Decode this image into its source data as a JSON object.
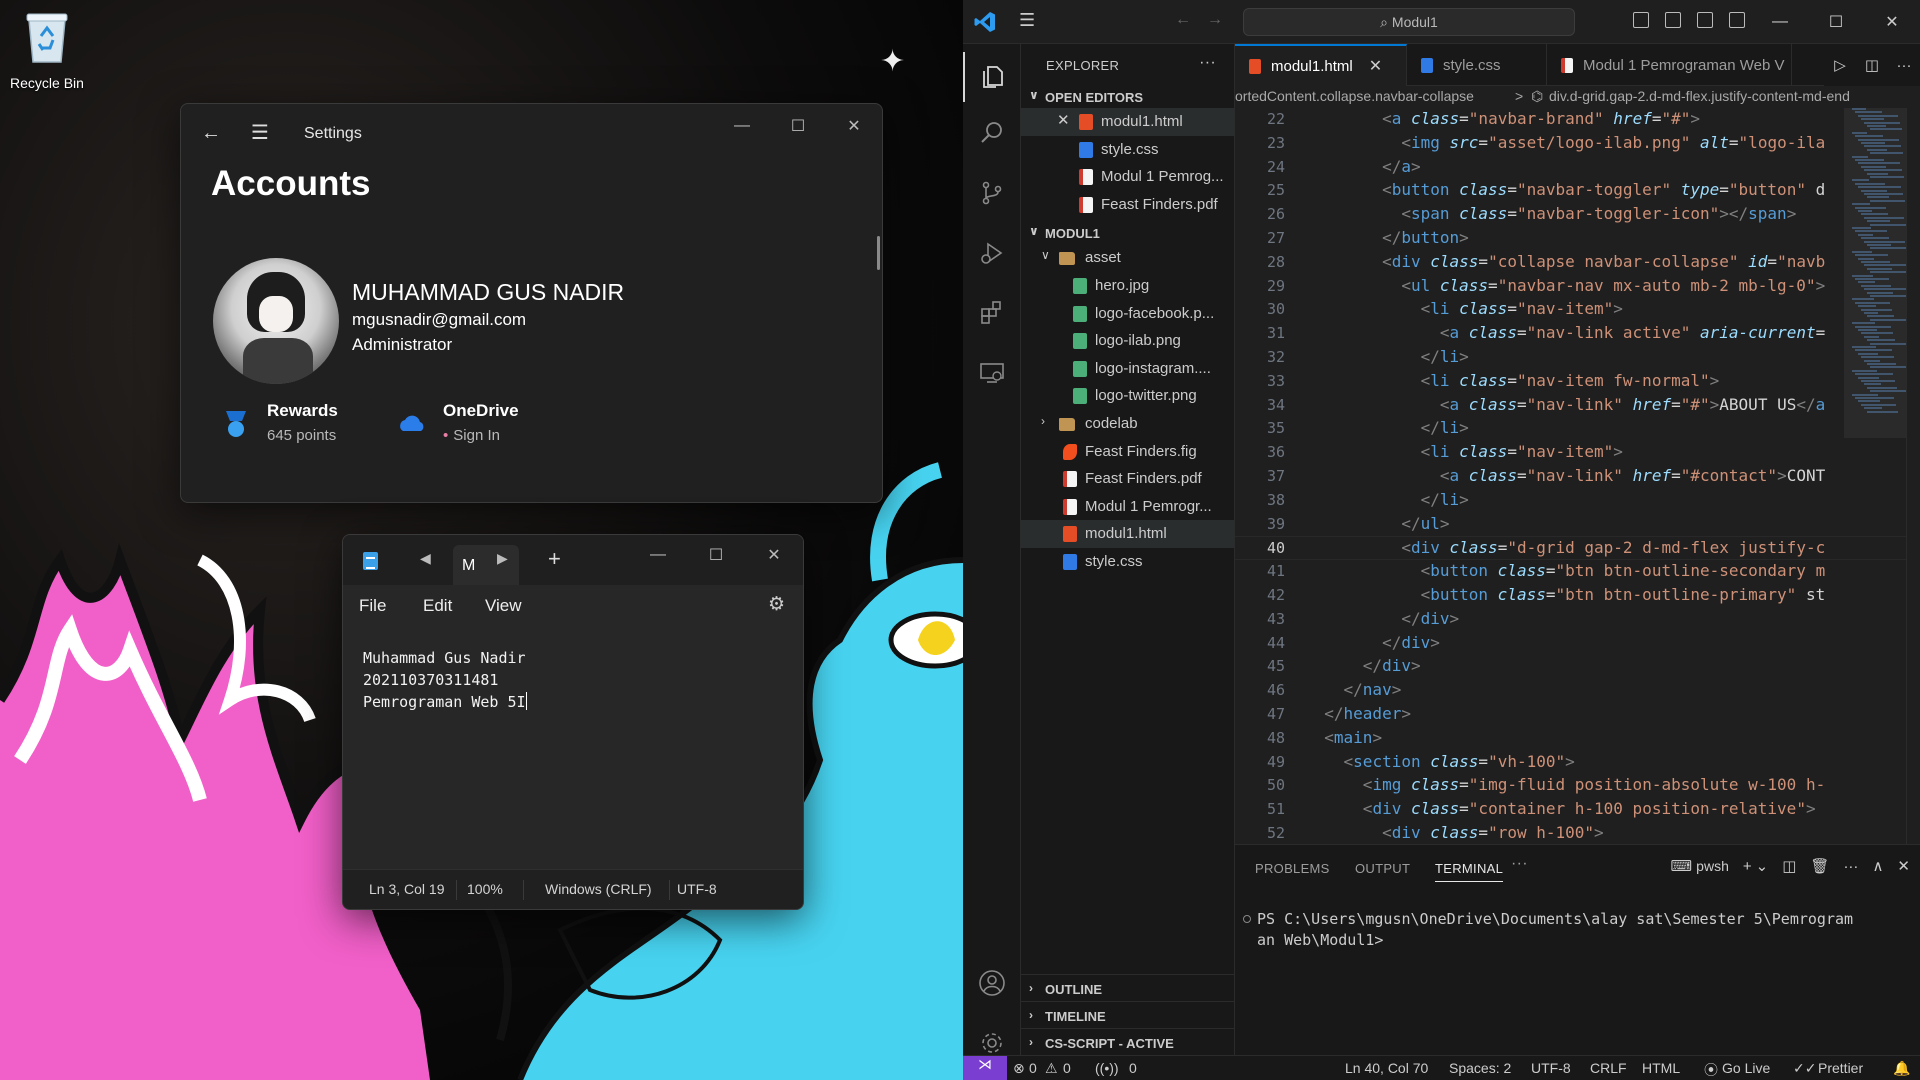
{
  "desktop": {
    "recycle_bin_label": "Recycle Bin"
  },
  "settings": {
    "window_title": "Settings",
    "page_title": "Accounts",
    "user_name": "MUHAMMAD GUS NADIR",
    "user_email": "mgusnadir@gmail.com",
    "user_role": "Administrator",
    "rewards": {
      "title": "Rewards",
      "subtitle": "645 points"
    },
    "onedrive": {
      "title": "OneDrive",
      "subtitle": "Sign In"
    }
  },
  "notepad": {
    "tab_label": "M",
    "menu": [
      "File",
      "Edit",
      "View"
    ],
    "lines": [
      "Muhammad Gus Nadir",
      "202110370311481",
      "Pemrograman Web 5I"
    ],
    "status": {
      "position": "Ln 3, Col 19",
      "zoom": "100%",
      "line_ending": "Windows (CRLF)",
      "encoding": "UTF-8"
    }
  },
  "vscode": {
    "search_label": "Modul1",
    "explorer_title": "EXPLORER",
    "open_editors_label": "OPEN EDITORS",
    "open_editors": [
      {
        "name": "modul1.html",
        "type": "html"
      },
      {
        "name": "style.css",
        "type": "css"
      },
      {
        "name": "Modul 1 Pemrog...",
        "type": "pdf"
      },
      {
        "name": "Feast Finders.pdf",
        "type": "pdf"
      }
    ],
    "workspace_label": "MODUL1",
    "tree": [
      {
        "name": "asset",
        "type": "folder"
      },
      {
        "name": "hero.jpg",
        "type": "img"
      },
      {
        "name": "logo-facebook.p...",
        "type": "img"
      },
      {
        "name": "logo-ilab.png",
        "type": "img"
      },
      {
        "name": "logo-instagram....",
        "type": "img"
      },
      {
        "name": "logo-twitter.png",
        "type": "img"
      },
      {
        "name": "codelab",
        "type": "folder"
      },
      {
        "name": "Feast Finders.fig",
        "type": "fig"
      },
      {
        "name": "Feast Finders.pdf",
        "type": "pdf"
      },
      {
        "name": "Modul 1 Pemrogr...",
        "type": "pdf"
      },
      {
        "name": "modul1.html",
        "type": "html"
      },
      {
        "name": "style.css",
        "type": "css"
      }
    ],
    "bottom_sections": [
      "OUTLINE",
      "TIMELINE",
      "CS-SCRIPT - ACTIVE"
    ],
    "tabs": [
      {
        "label": "modul1.html",
        "type": "html"
      },
      {
        "label": "style.css",
        "type": "css"
      },
      {
        "label": "Modul 1 Pemrograman Web V",
        "type": "pdf"
      }
    ],
    "breadcrumb": [
      "ortedContent.collapse.navbar-collapse",
      ">",
      "div.d-grid.gap-2.d-md-flex.justify-content-md-end"
    ],
    "code_lines": [
      {
        "n": "22",
        "t": "        <a class=\"navbar-brand\" href=\"#\">"
      },
      {
        "n": "23",
        "t": "          <img src=\"asset/logo-ilab.png\" alt=\"logo-ila"
      },
      {
        "n": "24",
        "t": "        </a>"
      },
      {
        "n": "25",
        "t": "        <button class=\"navbar-toggler\" type=\"button\" d"
      },
      {
        "n": "26",
        "t": "          <span class=\"navbar-toggler-icon\"></span>"
      },
      {
        "n": "27",
        "t": "        </button>"
      },
      {
        "n": "28",
        "t": "        <div class=\"collapse navbar-collapse\" id=\"navb"
      },
      {
        "n": "29",
        "t": "          <ul class=\"navbar-nav mx-auto mb-2 mb-lg-0\">"
      },
      {
        "n": "30",
        "t": "            <li class=\"nav-item\">"
      },
      {
        "n": "31",
        "t": "              <a class=\"nav-link active\" aria-current="
      },
      {
        "n": "32",
        "t": "            </li>"
      },
      {
        "n": "33",
        "t": "            <li class=\"nav-item fw-normal\">"
      },
      {
        "n": "34",
        "t": "              <a class=\"nav-link\" href=\"#\">ABOUT US</a"
      },
      {
        "n": "35",
        "t": "            </li>"
      },
      {
        "n": "36",
        "t": "            <li class=\"nav-item\">"
      },
      {
        "n": "37",
        "t": "              <a class=\"nav-link\" href=\"#contact\">CONT"
      },
      {
        "n": "38",
        "t": "            </li>"
      },
      {
        "n": "39",
        "t": "          </ul>"
      },
      {
        "n": "40",
        "t": "          <div class=\"d-grid gap-2 d-md-flex justify-c"
      },
      {
        "n": "41",
        "t": "            <button class=\"btn btn-outline-secondary m"
      },
      {
        "n": "42",
        "t": "            <button class=\"btn btn-outline-primary\" st"
      },
      {
        "n": "43",
        "t": "          </div>"
      },
      {
        "n": "44",
        "t": "        </div>"
      },
      {
        "n": "45",
        "t": "      </div>"
      },
      {
        "n": "46",
        "t": "    </nav>"
      },
      {
        "n": "47",
        "t": "  </header>"
      },
      {
        "n": "48",
        "t": "  <main>"
      },
      {
        "n": "49",
        "t": "    <section class=\"vh-100\">"
      },
      {
        "n": "50",
        "t": "      <img class=\"img-fluid position-absolute w-100 h-"
      },
      {
        "n": "51",
        "t": "      <div class=\"container h-100 position-relative\">"
      },
      {
        "n": "52",
        "t": "        <div class=\"row h-100\">"
      }
    ],
    "current_line": "40",
    "panel_tabs": [
      "PROBLEMS",
      "OUTPUT",
      "TERMINAL"
    ],
    "active_panel_tab": "TERMINAL",
    "terminal_shell": "pwsh",
    "terminal_lines": [
      "PS C:\\Users\\mgusn\\OneDrive\\Documents\\alay sat\\Semester 5\\Pemrogram",
      "an Web\\Modul1>"
    ],
    "status": {
      "errors": "0",
      "warnings": "0",
      "ports": "0",
      "cursor": "Ln 40, Col 70",
      "spaces": "Spaces: 2",
      "encoding": "UTF-8",
      "eol": "CRLF",
      "language": "HTML",
      "golive": "Go Live",
      "prettier": "Prettier"
    },
    "colors": {
      "accent": "#0078d4",
      "remote": "#7a3fd1",
      "html_icon": "#e44d26",
      "css_icon": "#2f7ae5"
    }
  }
}
